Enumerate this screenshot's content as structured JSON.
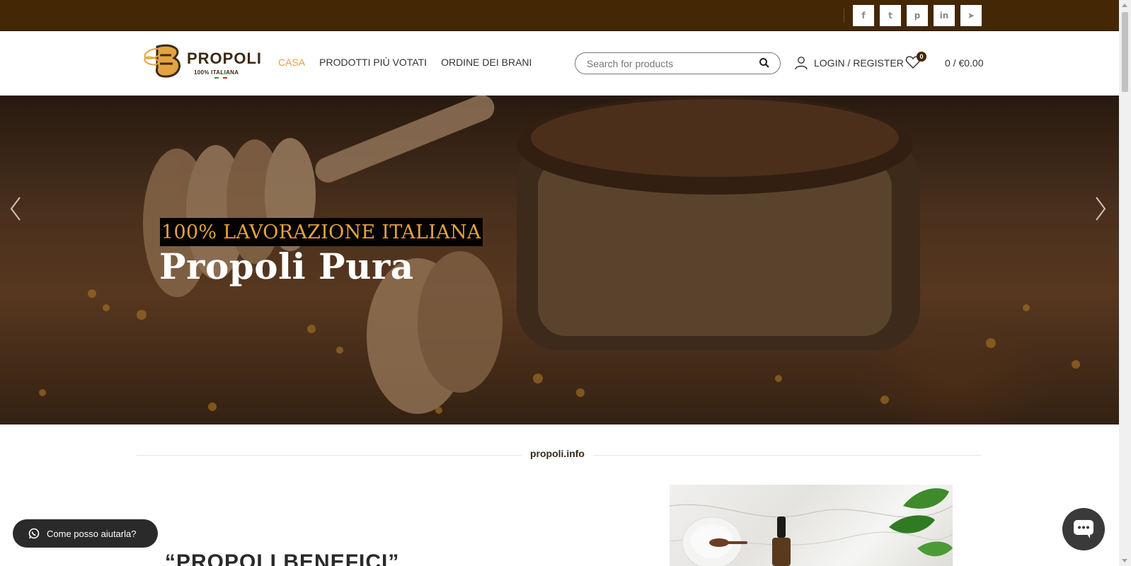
{
  "topbar": {
    "social": [
      {
        "name": "facebook",
        "glyph": "f"
      },
      {
        "name": "twitter",
        "glyph": "t"
      },
      {
        "name": "pinterest",
        "glyph": "p"
      },
      {
        "name": "linkedin",
        "glyph": "in"
      },
      {
        "name": "telegram",
        "glyph": "➤"
      }
    ]
  },
  "logo": {
    "word": "PROPOLI",
    "sub": "100% ITALIANA"
  },
  "nav": {
    "items": [
      "CASA",
      "PRODOTTI PIÙ VOTATI",
      "ORDINE DEI BRANI"
    ]
  },
  "search": {
    "placeholder": "Search for products"
  },
  "account": {
    "login_label": "LOGIN / REGISTER"
  },
  "wishlist": {
    "count": "0"
  },
  "cart": {
    "label": "0 / €0.00"
  },
  "hero": {
    "subtitle": "100% LAVORAZIONE ITALIANA",
    "title": "Propoli Pura"
  },
  "section": {
    "divider_label": "propoli.info",
    "title": "“PROPOLI BENEFICI”"
  },
  "widgets": {
    "whatsapp_label": "Come posso aiutarla?"
  },
  "colors": {
    "topbar": "#442704",
    "accent": "#e3a341"
  }
}
